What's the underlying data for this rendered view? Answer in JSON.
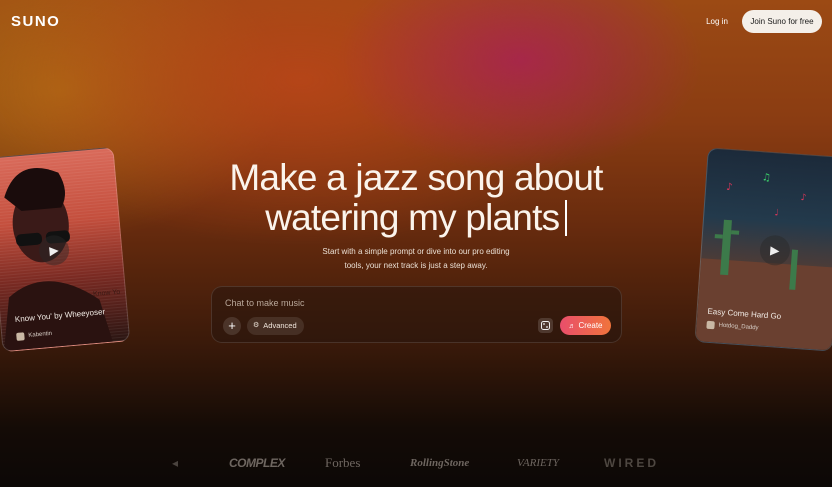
{
  "header": {
    "logo": "SUNO",
    "login": "Log in",
    "join": "Join Suno for free"
  },
  "hero": {
    "line1": "Make a jazz song about",
    "line2": "watering my plants",
    "subtitle_line1": "Start with a simple prompt or dive into our pro editing",
    "subtitle_line2": "tools, your next track is just a step away."
  },
  "chat": {
    "placeholder": "Chat to make music",
    "plus": "+",
    "advanced": "Advanced",
    "create": "Create"
  },
  "cards": {
    "left": {
      "title": "Know You' by Wheeyoser",
      "user": "Kabentin",
      "overlay": "Know Yo"
    },
    "right": {
      "title": "Easy Come Hard Go",
      "user": "Hotdog_Daddy"
    }
  },
  "press": [
    "COMPLEX",
    "Forbes",
    "RollingStone",
    "VARIETY",
    "WIRED"
  ],
  "colors": {
    "create_start": "#e94e6b",
    "create_end": "#f0743c",
    "join_bg": "#f4efe9"
  },
  "icons": [
    "plus-icon",
    "tune-icon",
    "dice-icon",
    "music-note-icon",
    "play-icon"
  ]
}
